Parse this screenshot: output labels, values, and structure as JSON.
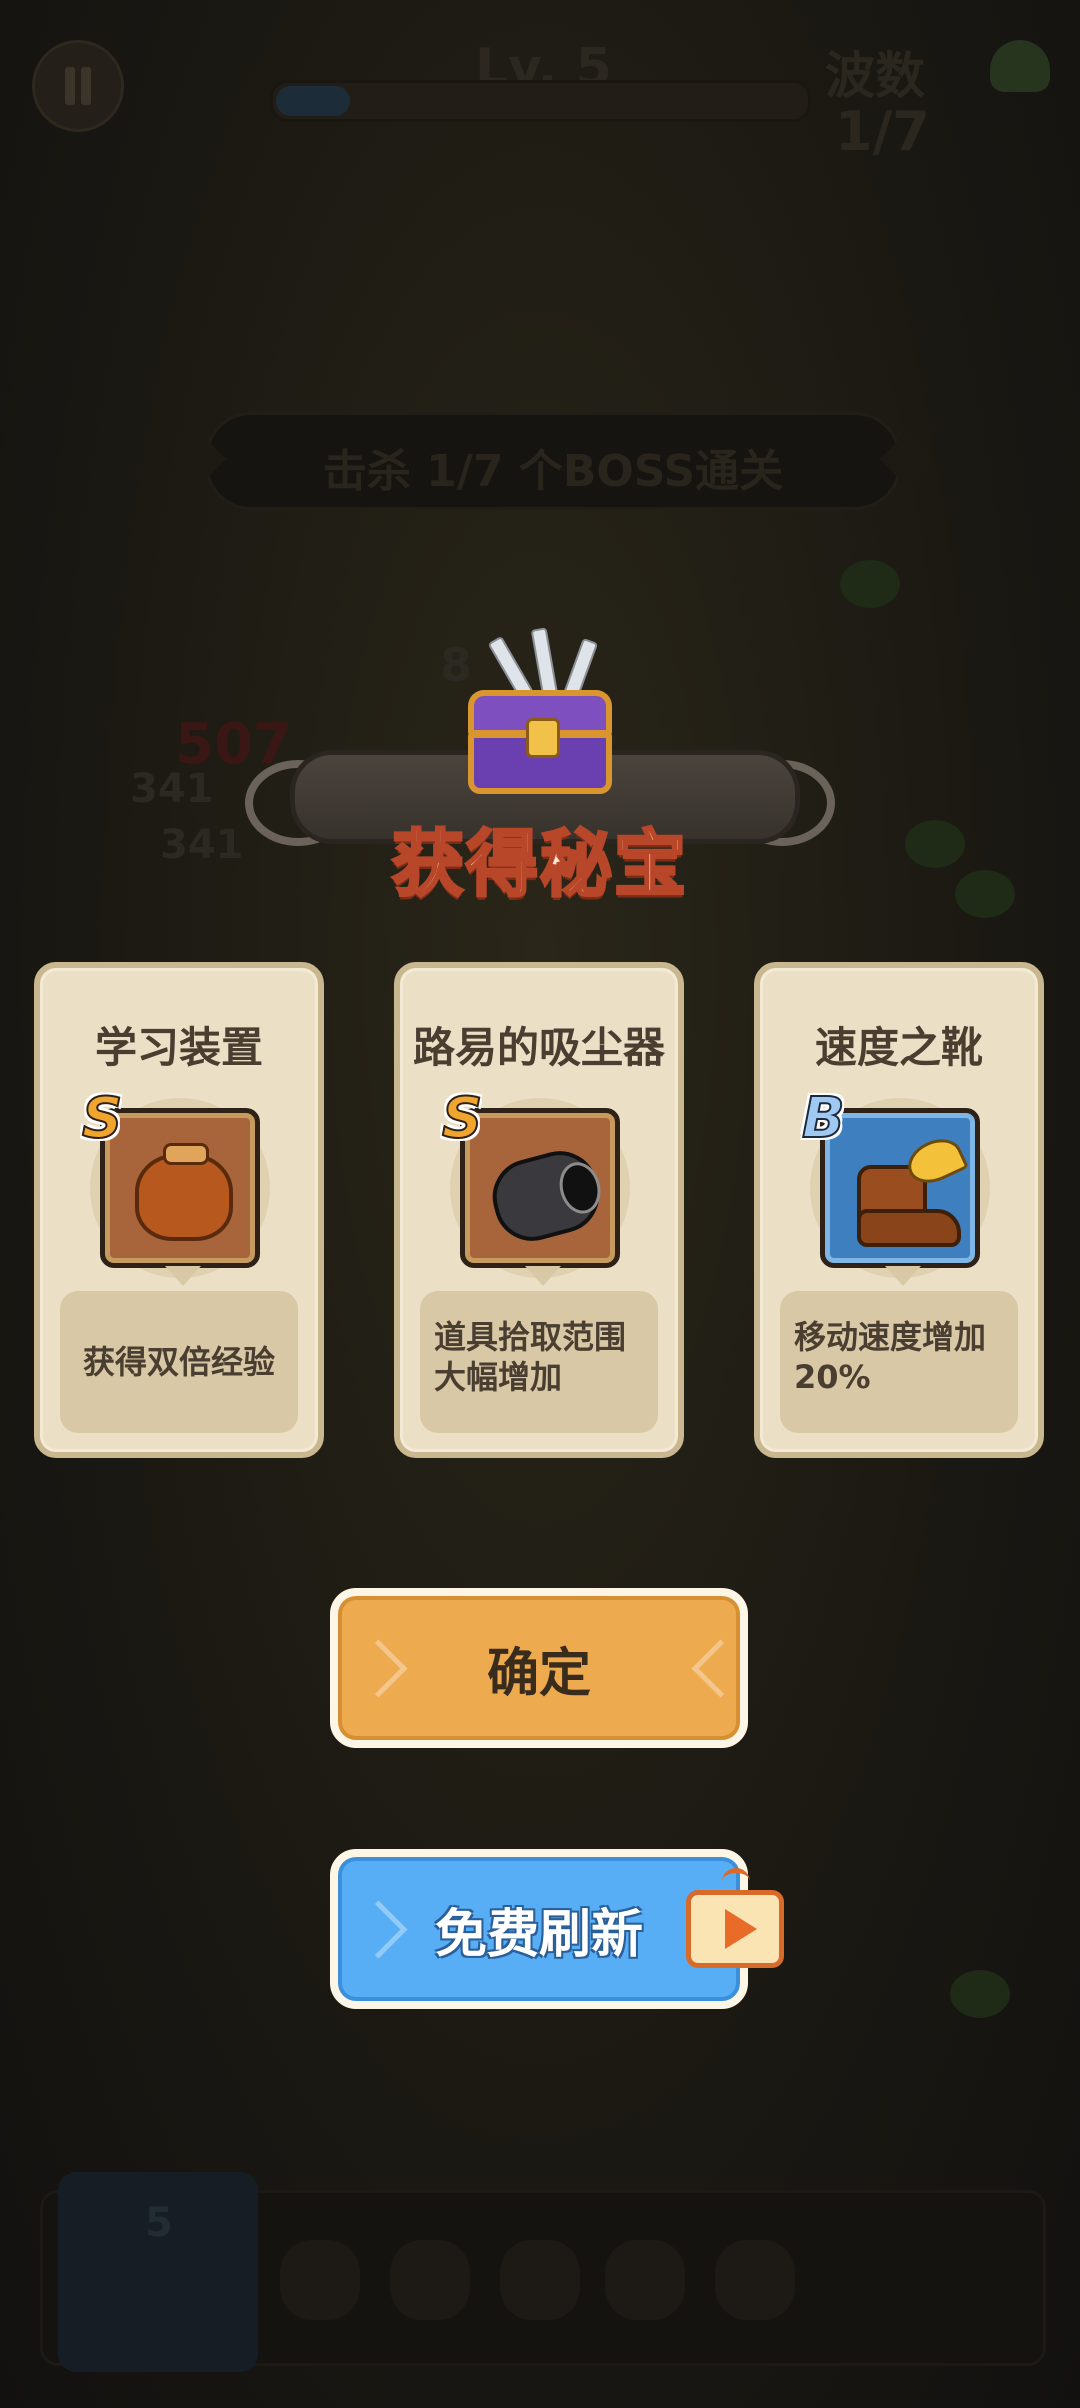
{
  "hud": {
    "level_label": "Lv. 5",
    "xp_progress": 0.14,
    "wave_label": "波数",
    "wave_count": "1/7"
  },
  "objective": {
    "text": "击杀  1/7  个BOSS通关"
  },
  "background_numbers": [
    "8",
    "507",
    "341",
    "341",
    "5"
  ],
  "reward": {
    "title": "获得秘宝",
    "cards": [
      {
        "name": "学习装置",
        "rank": "S",
        "icon": "bag-icon",
        "description": "获得双倍经验"
      },
      {
        "name": "路易的吸尘器",
        "rank": "S",
        "icon": "vacuum-icon",
        "description": "道具拾取范围大幅增加"
      },
      {
        "name": "速度之靴",
        "rank": "B",
        "icon": "winged-boot-icon",
        "description": "移动速度增加20%"
      }
    ]
  },
  "buttons": {
    "confirm_label": "确定",
    "refresh_label": "免费刷新",
    "refresh_ad_icon": "tv-play-icon"
  },
  "colors": {
    "confirm": "#eeaa4e",
    "refresh": "#58aef5",
    "card_bg": "#ebe0c6",
    "title_stroke": "#b8472a"
  }
}
